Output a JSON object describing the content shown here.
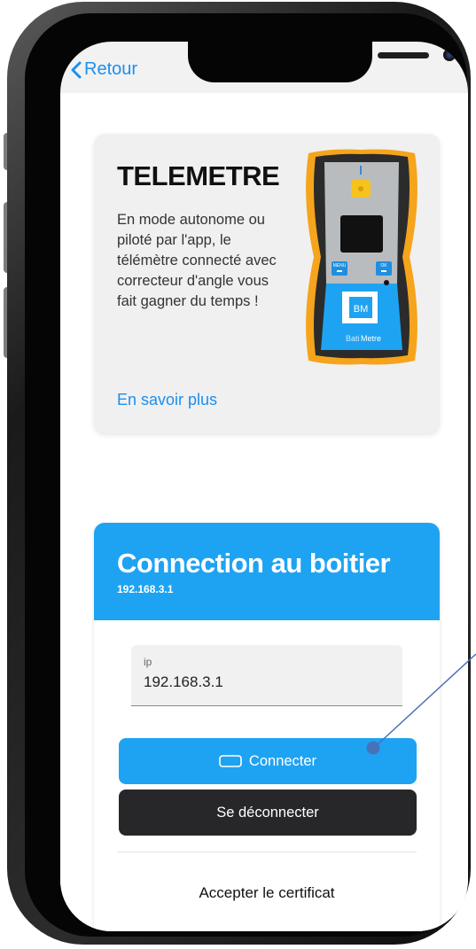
{
  "nav": {
    "back_label": "Retour"
  },
  "product_card": {
    "title": "TELEMETRE",
    "description": "En mode autonome ou piloté par l'app, le télémètre connecté avec correcteur d'angle vous fait gagner du temps !",
    "link_label": "En savoir plus",
    "device": {
      "menu_label": "MENU",
      "ok_label": "OK",
      "logo_text": "BM",
      "brand_prefix": "Bati",
      "brand_suffix": "Metre"
    }
  },
  "connection": {
    "title": "Connection au boitier",
    "subtitle": "192.168.3.1",
    "ip_field": {
      "label": "ip",
      "value": "192.168.3.1"
    },
    "connect_label": "Connecter",
    "disconnect_label": "Se déconnecter",
    "accept_label": "Accepter le certificat"
  },
  "colors": {
    "accent": "#1ea3f2",
    "link": "#1a8ff0",
    "dark_button": "#27272a",
    "device_orange": "#f5a41c",
    "annotation": "#4a6fb5"
  },
  "icons": [
    "chevron-left-icon",
    "connect-icon"
  ]
}
